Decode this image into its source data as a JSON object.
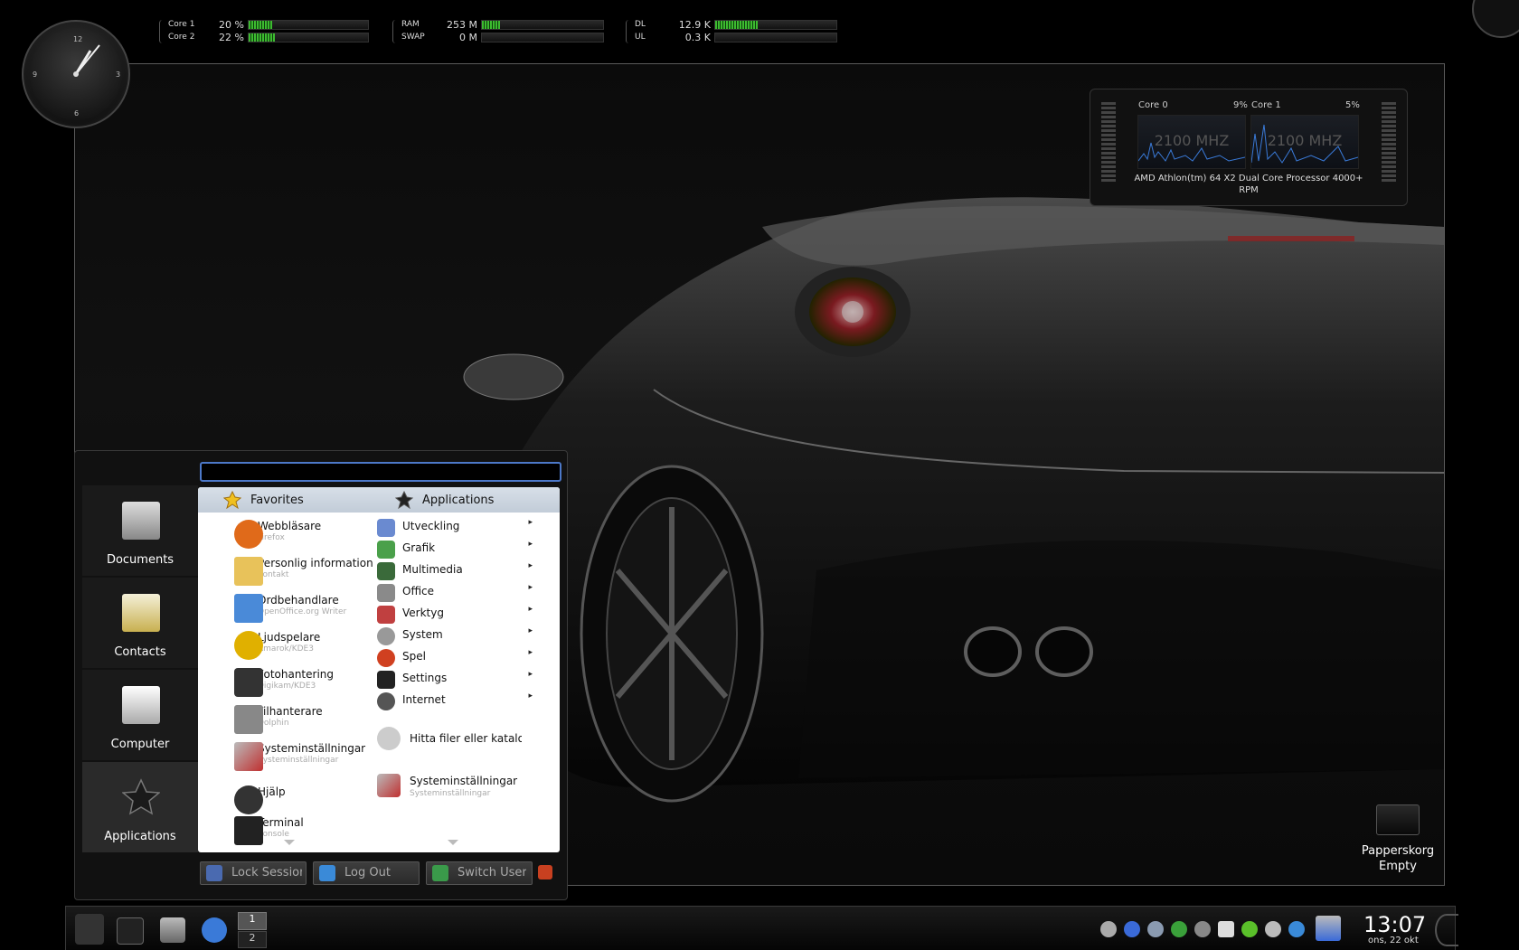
{
  "monitors": {
    "cpu": {
      "rows": [
        {
          "label": "Core 1",
          "value": "20 %",
          "level": 0.2
        },
        {
          "label": "Core 2",
          "value": "22 %",
          "level": 0.22
        }
      ]
    },
    "mem": {
      "rows": [
        {
          "label": "RAM",
          "value": "253 M",
          "level": 0.15
        },
        {
          "label": "SWAP",
          "value": "0 M",
          "level": 0.0
        }
      ]
    },
    "net": {
      "rows": [
        {
          "label": "DL",
          "value": "12.9 K",
          "level": 0.35
        },
        {
          "label": "UL",
          "value": "0.3 K",
          "level": 0.0
        }
      ]
    }
  },
  "clock_face": {
    "n12": "12",
    "n3": "3",
    "n6": "6",
    "n9": "9"
  },
  "cpu_widget": {
    "core0_label": "Core 0",
    "core0_pct": "9%",
    "core1_label": "Core 1",
    "core1_pct": "5%",
    "freq0": "2100 MHZ",
    "freq1": "2100 MHZ",
    "model": "AMD Athlon(tm) 64 X2 Dual Core Processor 4000+",
    "model2": "RPM"
  },
  "launcher": {
    "side": [
      {
        "label": "Documents",
        "icon": "computer-documents-icon"
      },
      {
        "label": "Contacts",
        "icon": "contacts-icon"
      },
      {
        "label": "Computer",
        "icon": "monitor-icon"
      },
      {
        "label": "Applications",
        "icon": "star-icon"
      }
    ],
    "favorites_header": "Favorites",
    "applications_header": "Applications",
    "favorites": [
      {
        "title": "Webbläsare",
        "sub": "Firefox",
        "color": "#e06a1a"
      },
      {
        "title": "Personlig information",
        "sub": "Kontakt",
        "color": "#e8c25a"
      },
      {
        "title": "Ordbehandlare",
        "sub": "OpenOffice.org Writer",
        "color": "#4a8ad8"
      },
      {
        "title": "Ljudspelare",
        "sub": "Amarok/KDE3",
        "color": "#e0b000"
      },
      {
        "title": "Fotohantering",
        "sub": "Digikam/KDE3",
        "color": "#333"
      },
      {
        "title": "Filhanterare",
        "sub": "Dolphin",
        "color": "#888"
      },
      {
        "title": "Systeminställningar",
        "sub": "Systeminställningar",
        "color": "#c03030"
      },
      {
        "title": "Hjälp",
        "sub": "",
        "color": "#333"
      },
      {
        "title": "Terminal",
        "sub": "Konsole",
        "color": "#222"
      }
    ],
    "apps": [
      {
        "title": "Utveckling",
        "color": "#6a8ad0"
      },
      {
        "title": "Grafik",
        "color": "#4aa04a"
      },
      {
        "title": "Multimedia",
        "color": "#3a6a3a"
      },
      {
        "title": "Office",
        "color": "#8a8a8a"
      },
      {
        "title": "Verktyg",
        "color": "#c04040"
      },
      {
        "title": "System",
        "color": "#999"
      },
      {
        "title": "Spel",
        "color": "#d04020"
      },
      {
        "title": "Settings",
        "color": "#222"
      },
      {
        "title": "Internet",
        "color": "#555"
      }
    ],
    "arrow": "▸",
    "find_label": "Hitta filer eller katalog",
    "settings_title": "Systeminställningar",
    "settings_sub": "Systeminställningar",
    "lock_label": "Lock Session",
    "logout_label": "Log Out",
    "switch_label": "Switch User"
  },
  "trash": {
    "title": "Papperskorg",
    "status": "Empty"
  },
  "taskbar": {
    "pager": [
      "1",
      "2"
    ],
    "time": "13:07",
    "date": "ons, 22 okt"
  }
}
